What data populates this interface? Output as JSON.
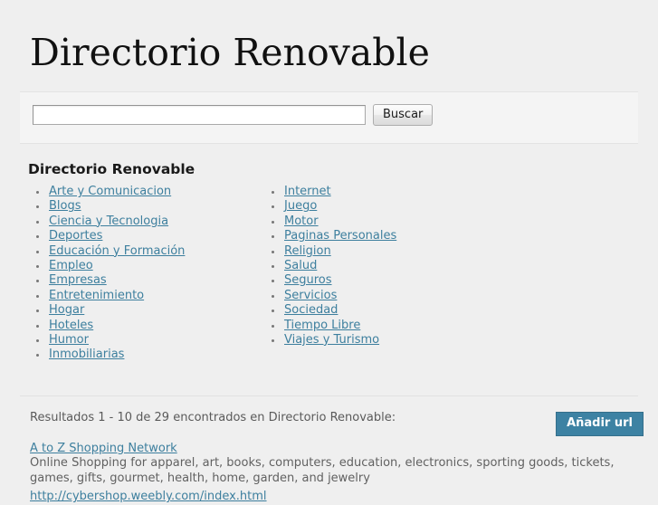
{
  "site": {
    "title": "Directorio Renovable"
  },
  "search": {
    "value": "",
    "placeholder": "",
    "button_label": "Buscar"
  },
  "directory": {
    "heading": "Directorio Renovable",
    "columns": [
      {
        "items": [
          "Arte y Comunicacion",
          "Blogs",
          "Ciencia y Tecnologia",
          "Deportes",
          "Educación y Formación",
          "Empleo",
          "Empresas",
          "Entretenimiento",
          "Hogar",
          "Hoteles",
          "Humor",
          "Inmobiliarias"
        ]
      },
      {
        "items": [
          "Internet",
          "Juego",
          "Motor",
          "Paginas Personales",
          "Religion",
          "Salud",
          "Seguros",
          "Servicios",
          "Sociedad",
          "Tiempo Libre",
          "Viajes y Turismo"
        ]
      }
    ]
  },
  "results": {
    "count_text": "Resultados 1 - 10 de 29 encontrados en Directorio Renovable:",
    "add_url_label": "Añadir url",
    "items": [
      {
        "title": "A to Z Shopping Network",
        "description": "Online Shopping for apparel, art, books, computers, education, electronics, sporting goods, tickets, games, gifts, gourmet, health, home, garden, and jewelry",
        "url": "http://cybershop.weebly.com/index.html"
      }
    ]
  },
  "colors": {
    "page_background": "#efefef",
    "panel_background": "#f4f4f4",
    "link": "#3d7f9e",
    "accent_button": "#3d82a3",
    "text": "#555555"
  }
}
